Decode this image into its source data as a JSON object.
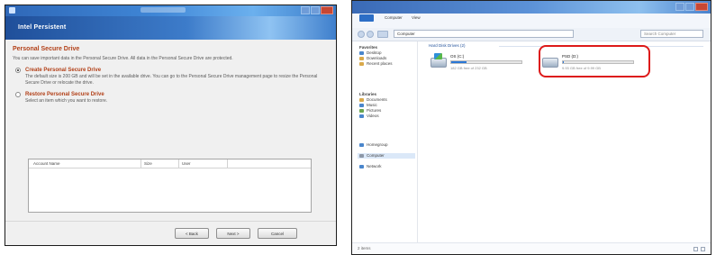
{
  "dialog": {
    "window_title": "",
    "header_title": "Intel Persistent",
    "section_title": "Personal Secure Drive",
    "intro": "You can save important data in the Personal Secure Drive. All data in the Personal Secure Drive are protected.",
    "options": [
      {
        "title": "Create Personal Secure Drive",
        "text": "The default size is 200 GB and will be set in the available drive. You can go to the Personal Secure Drive management page to resize the Personal Secure Drive or relocate the drive.",
        "selected": true
      },
      {
        "title": "Restore Personal Secure Drive",
        "text": "Select an item which you want to restore.",
        "selected": false
      }
    ],
    "table_columns": [
      "Account Name",
      "Size",
      "User"
    ],
    "buttons": {
      "back": "< Back",
      "next": "Next >",
      "cancel": "Cancel"
    }
  },
  "explorer": {
    "ribbon_tabs": [
      "Computer",
      "View"
    ],
    "address": "Computer",
    "search_placeholder": "Search Computer",
    "nav": {
      "favorites_label": "Favorites",
      "favorites": [
        "Desktop",
        "Downloads",
        "Recent places"
      ],
      "libraries_label": "Libraries",
      "libraries": [
        "Documents",
        "Music",
        "Pictures",
        "Videos"
      ],
      "homegroup": "Homegroup",
      "computer": "Computer",
      "network": "Network"
    },
    "group_header": "Hard Disk Drives (2)",
    "drives": [
      {
        "name": "OS (C:)",
        "free": "182 GB free of 232 GB",
        "usage": 0.22
      },
      {
        "name": "PSD (D:)",
        "free": "9.93 GB free of 9.99 GB",
        "usage": 0.01
      }
    ],
    "status": "2 items",
    "highlight_color": "#dd1a1a"
  }
}
